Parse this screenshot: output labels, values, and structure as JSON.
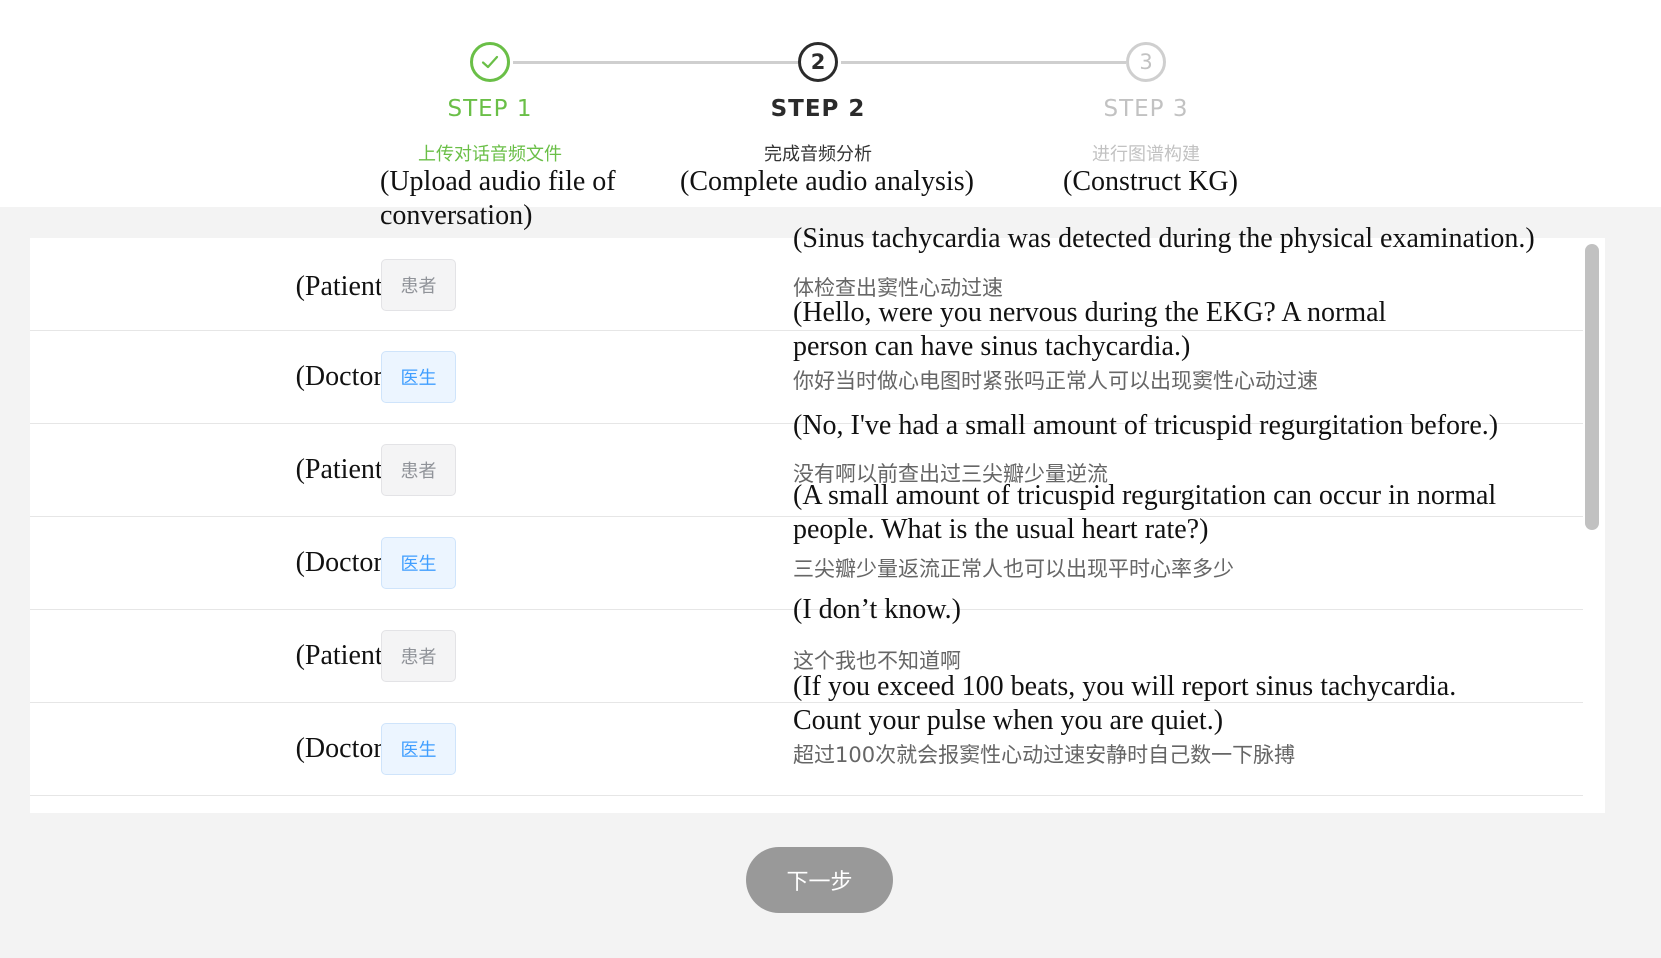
{
  "steps": [
    {
      "title": "STEP 1",
      "subtitle": "上传对话音频文件",
      "translation_line1": "(Upload audio file of",
      "translation_line2": "conversation)",
      "state": "done",
      "color": "#6abf47"
    },
    {
      "title": "STEP 2",
      "number": "2",
      "subtitle": "完成音频分析",
      "translation": "(Complete audio analysis)",
      "state": "active",
      "color": "#2b2b2b"
    },
    {
      "title": "STEP 3",
      "number": "3",
      "subtitle": "进行图谱构建",
      "translation": "(Construct KG)",
      "state": "pending",
      "color": "#c2c2c2"
    }
  ],
  "conversation": [
    {
      "role_en": "(Patient)",
      "role_badge": "患者",
      "role": "patient",
      "en_lines": [
        "(Sinus tachycardia was detected during the physical examination.)"
      ],
      "zh": "体检查出窦性心动过速"
    },
    {
      "role_en": "(Doctor)",
      "role_badge": "医生",
      "role": "doctor",
      "en_lines": [
        "(Hello, were you nervous during the EKG? A normal",
        "person can have sinus tachycardia.)"
      ],
      "zh": "你好当时做心电图时紧张吗正常人可以出现窦性心动过速"
    },
    {
      "role_en": "(Patient)",
      "role_badge": "患者",
      "role": "patient",
      "en_lines": [
        "(No, I've had a small amount of tricuspid regurgitation before.)"
      ],
      "zh": "没有啊以前查出过三尖瓣少量逆流"
    },
    {
      "role_en": "(Doctor)",
      "role_badge": "医生",
      "role": "doctor",
      "en_lines": [
        "(A small amount of tricuspid regurgitation can occur in normal",
        "people. What is the usual heart rate?)"
      ],
      "zh": "三尖瓣少量返流正常人也可以出现平时心率多少"
    },
    {
      "role_en": "(Patient)",
      "role_badge": "患者",
      "role": "patient",
      "en_lines": [
        "(I don’t know.)"
      ],
      "zh": "这个我也不知道啊"
    },
    {
      "role_en": "(Doctor)",
      "role_badge": "医生",
      "role": "doctor",
      "en_lines": [
        "(If you exceed 100 beats, you will report sinus tachycardia.",
        "Count your pulse when you are quiet.)"
      ],
      "zh": "超过100次就会报窦性心动过速安静时自己数一下脉搏"
    }
  ],
  "next_button": {
    "label": "下一步"
  },
  "colors": {
    "done": "#6abf47",
    "patient_badge": "#909399",
    "doctor_badge": "#409eff",
    "button_bg": "#999999"
  }
}
